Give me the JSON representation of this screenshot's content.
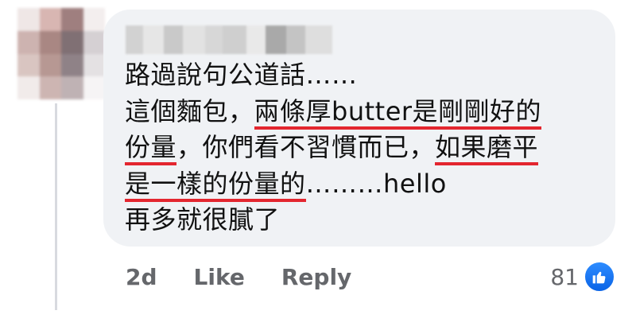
{
  "comment": {
    "lines": [
      {
        "segments": [
          {
            "text": "路過說句公道話……",
            "underline": false
          }
        ]
      },
      {
        "segments": [
          {
            "text": "這個麵包，",
            "underline": false
          },
          {
            "text": "兩條厚butter是剛剛好的",
            "underline": true
          }
        ]
      },
      {
        "segments": [
          {
            "text": "份量",
            "underline": true
          },
          {
            "text": "，你們看不習慣而已，",
            "underline": false
          },
          {
            "text": "如果磨平",
            "underline": true
          }
        ]
      },
      {
        "segments": [
          {
            "text": "是一樣的份量的",
            "underline": true
          },
          {
            "text": "………hello",
            "underline": false
          }
        ]
      },
      {
        "segments": [
          {
            "text": "再多就很膩了",
            "underline": false
          }
        ]
      }
    ]
  },
  "actions": {
    "time": "2d",
    "like_label": "Like",
    "reply_label": "Reply"
  },
  "reactions": {
    "count": "81",
    "icon": "thumbs-up-icon"
  },
  "colors": {
    "bubble": "#f0f2f5",
    "underline": "#e3262f",
    "like_badge": "#1877f2",
    "meta_text": "#65676b"
  }
}
